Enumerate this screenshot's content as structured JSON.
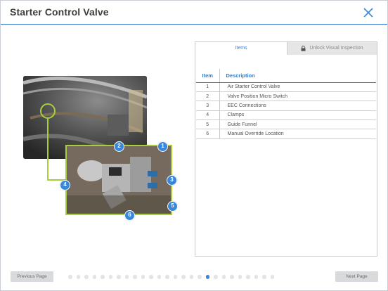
{
  "header": {
    "title": "Starter Control Valve",
    "close_icon": "close-icon"
  },
  "figure": {
    "callouts": [
      "1",
      "2",
      "3",
      "4",
      "5",
      "6"
    ],
    "highlight_color": "#a8cf3a",
    "callout_color": "#3a86d9"
  },
  "panel": {
    "tabs": {
      "items_label": "Items",
      "locked_label": "Unlock Visual Inspection",
      "lock_icon": "lock-icon"
    },
    "table": {
      "headers": [
        "Item",
        "Description"
      ],
      "rows": [
        {
          "item": "1",
          "description": "Air Starter Control Valve"
        },
        {
          "item": "2",
          "description": "Valve Position Micro Switch"
        },
        {
          "item": "3",
          "description": "EEC Connections"
        },
        {
          "item": "4",
          "description": "Clamps"
        },
        {
          "item": "5",
          "description": "Guide Funnel"
        },
        {
          "item": "6",
          "description": "Manual Override Location"
        }
      ]
    }
  },
  "footer": {
    "prev_label": "Previous Page",
    "next_label": "Next Page",
    "pager": {
      "total": 26,
      "current": 18
    }
  },
  "colors": {
    "accent": "#3a86d9",
    "header_rule": "#3a7bd5"
  }
}
